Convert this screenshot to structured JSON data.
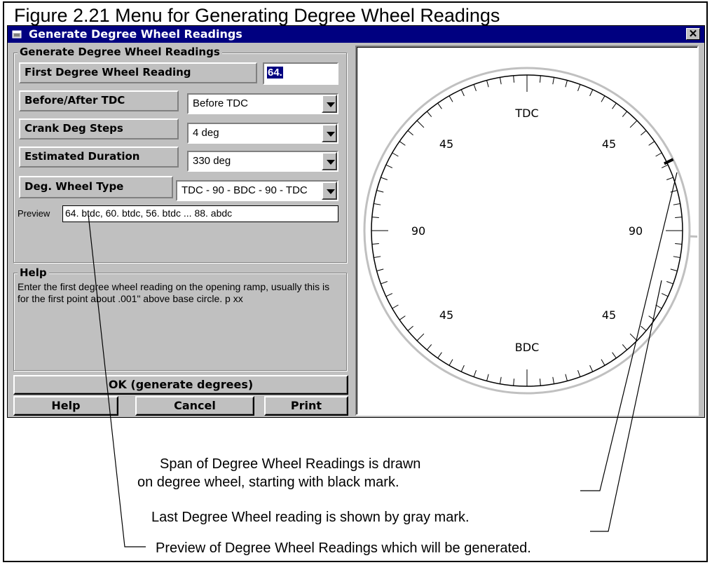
{
  "figure": {
    "title": "Figure 2.21  Menu for Generating Degree Wheel Readings"
  },
  "window": {
    "title": "Generate Degree Wheel Readings",
    "close_label": "✕"
  },
  "form": {
    "group_label": "Generate Degree Wheel Readings",
    "first_reading_label": "First Degree Wheel Reading",
    "first_reading_value": "64.",
    "before_after_label": "Before/After TDC",
    "before_after_value": "Before TDC",
    "crank_steps_label": "Crank Deg Steps",
    "crank_steps_value": "4 deg",
    "est_duration_label": "Estimated Duration",
    "est_duration_value": "330 deg",
    "wheel_type_label": "Deg. Wheel Type",
    "wheel_type_value": "TDC - 90 - BDC - 90 - TDC",
    "preview_label": "Preview",
    "preview_value": "64. btdc, 60. btdc, 56. btdc ... 88. abdc"
  },
  "help": {
    "group_label": "Help",
    "text": "Enter the first degree wheel reading on the opening ramp, usually this is for the first point about .001\" above base circle. p xx"
  },
  "buttons": {
    "ok": "OK (generate degrees)",
    "help": "Help",
    "cancel": "Cancel",
    "print": "Print"
  },
  "wheel": {
    "labels": {
      "top": "TDC",
      "bottom": "BDC",
      "left": "90",
      "right": "90",
      "upper_left": "45",
      "upper_right": "45",
      "lower_left": "45",
      "lower_right": "45"
    },
    "first_reading_deg_btdc": 64,
    "last_reading_deg_abdc": 88,
    "span_color": "#c0c0c0",
    "start_mark_color": "#000000"
  },
  "annotations": {
    "span_line1": "Span of Degree Wheel Readings is drawn",
    "span_line2": "on degree wheel, starting with black mark.",
    "last": "Last Degree Wheel reading is shown by gray mark.",
    "preview": "Preview of Degree Wheel Readings which will be generated."
  },
  "colors": {
    "titlebar": "#000080",
    "face": "#c0c0c0",
    "selection": "#000080"
  }
}
